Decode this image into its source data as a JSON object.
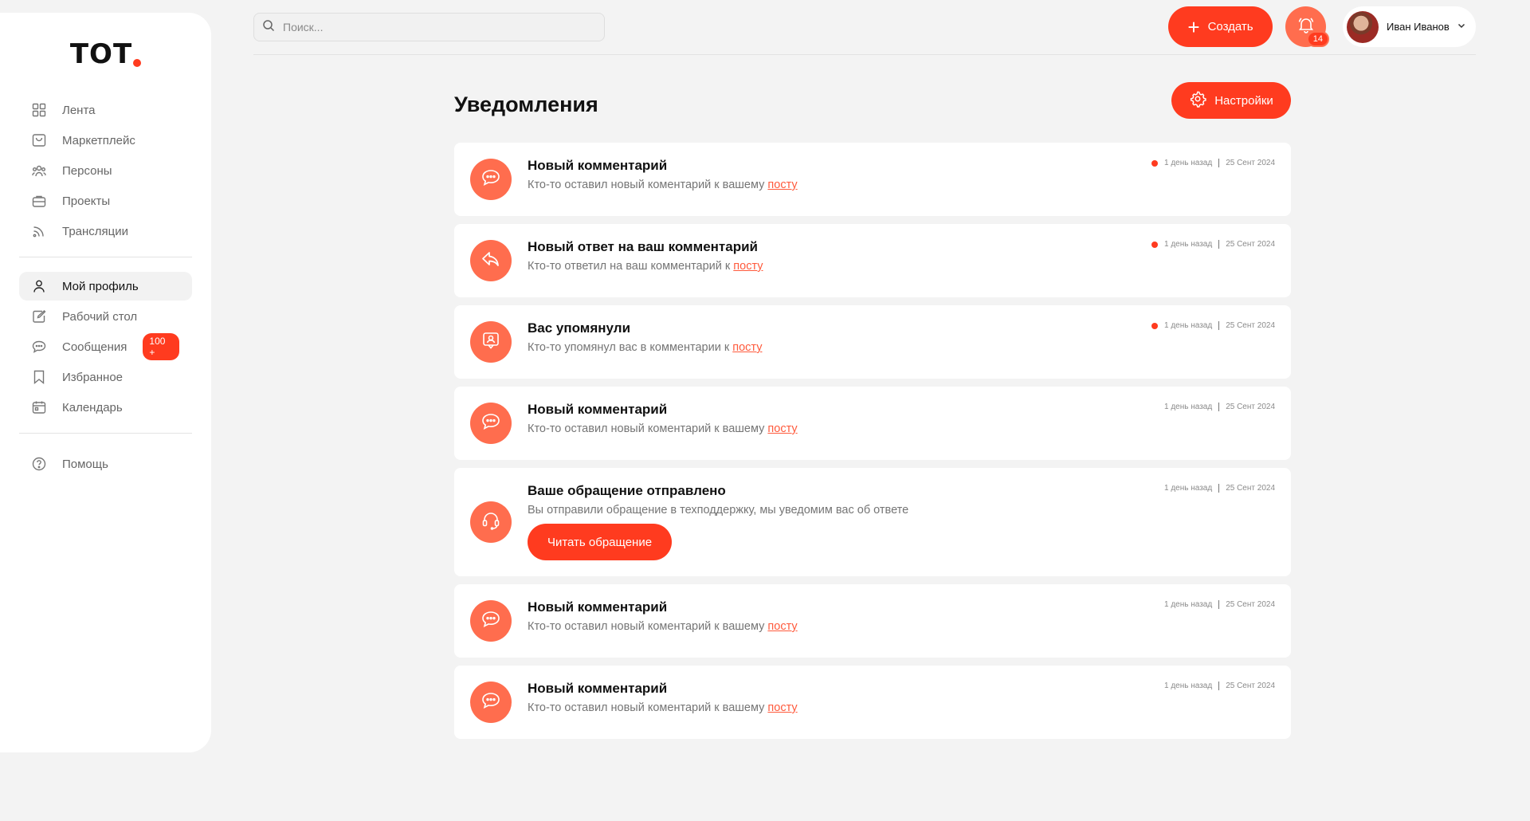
{
  "brand": {
    "logo_text": "ТОТ"
  },
  "sidebar": {
    "primary": [
      {
        "label": "Лента",
        "icon": "grid-icon"
      },
      {
        "label": "Маркетплейс",
        "icon": "bag-icon"
      },
      {
        "label": "Персоны",
        "icon": "people-icon"
      },
      {
        "label": "Проекты",
        "icon": "briefcase-icon"
      },
      {
        "label": "Трансляции",
        "icon": "broadcast-icon"
      }
    ],
    "secondary": [
      {
        "label": "Мой профиль",
        "icon": "user-icon",
        "active": true
      },
      {
        "label": "Рабочий стол",
        "icon": "edit-icon"
      },
      {
        "label": "Сообщения",
        "icon": "chat-icon",
        "badge": "100 +"
      },
      {
        "label": "Избранное",
        "icon": "bookmark-icon"
      },
      {
        "label": "Календарь",
        "icon": "calendar-icon"
      }
    ],
    "help": {
      "label": "Помощь",
      "icon": "help-icon"
    }
  },
  "topbar": {
    "search_placeholder": "Поиск...",
    "create_label": "Создать",
    "notifications_count": "14",
    "user_name": "Иван Иванов"
  },
  "page": {
    "title": "Уведомления",
    "settings_label": "Настройки"
  },
  "notifications": [
    {
      "title": "Новый комментарий",
      "text": "Кто-то оставил новый коментарий к вашему ",
      "link": "посту",
      "time": "1 день назад",
      "date": "25 Сент 2024",
      "unread": true,
      "icon": "comment-icon"
    },
    {
      "title": "Новый ответ на ваш комментарий",
      "text": "Кто-то ответил на ваш комментарий к ",
      "link": "посту",
      "time": "1 день назад",
      "date": "25 Сент 2024",
      "unread": true,
      "icon": "reply-icon"
    },
    {
      "title": "Вас упомянули",
      "text": "Кто-то упомянул вас в комментарии к ",
      "link": "посту",
      "time": "1 день назад",
      "date": "25 Сент 2024",
      "unread": true,
      "icon": "mention-icon"
    },
    {
      "title": "Новый комментарий",
      "text": "Кто-то оставил новый коментарий к вашему ",
      "link": "посту",
      "time": "1 день назад",
      "date": "25 Сент 2024",
      "unread": false,
      "icon": "comment-icon"
    },
    {
      "title": "Ваше обращение отправлено",
      "text": "Вы отправили обращение в техподдержку, мы уведомим вас об ответе",
      "link": "",
      "time": "1 день назад",
      "date": "25 Сент 2024",
      "unread": false,
      "icon": "headset-icon",
      "button": "Читать обращение"
    },
    {
      "title": "Новый комментарий",
      "text": "Кто-то оставил новый коментарий к вашему ",
      "link": "посту",
      "time": "1 день назад",
      "date": "25 Сент 2024",
      "unread": false,
      "icon": "comment-icon"
    },
    {
      "title": "Новый комментарий",
      "text": "Кто-то оставил новый коментарий к вашему ",
      "link": "посту",
      "time": "1 день назад",
      "date": "25 Сент 2024",
      "unread": false,
      "icon": "comment-icon"
    }
  ],
  "colors": {
    "accent": "#ff3b1f",
    "icon_circle": "#ff6d4e",
    "background": "#f3f3f3"
  }
}
